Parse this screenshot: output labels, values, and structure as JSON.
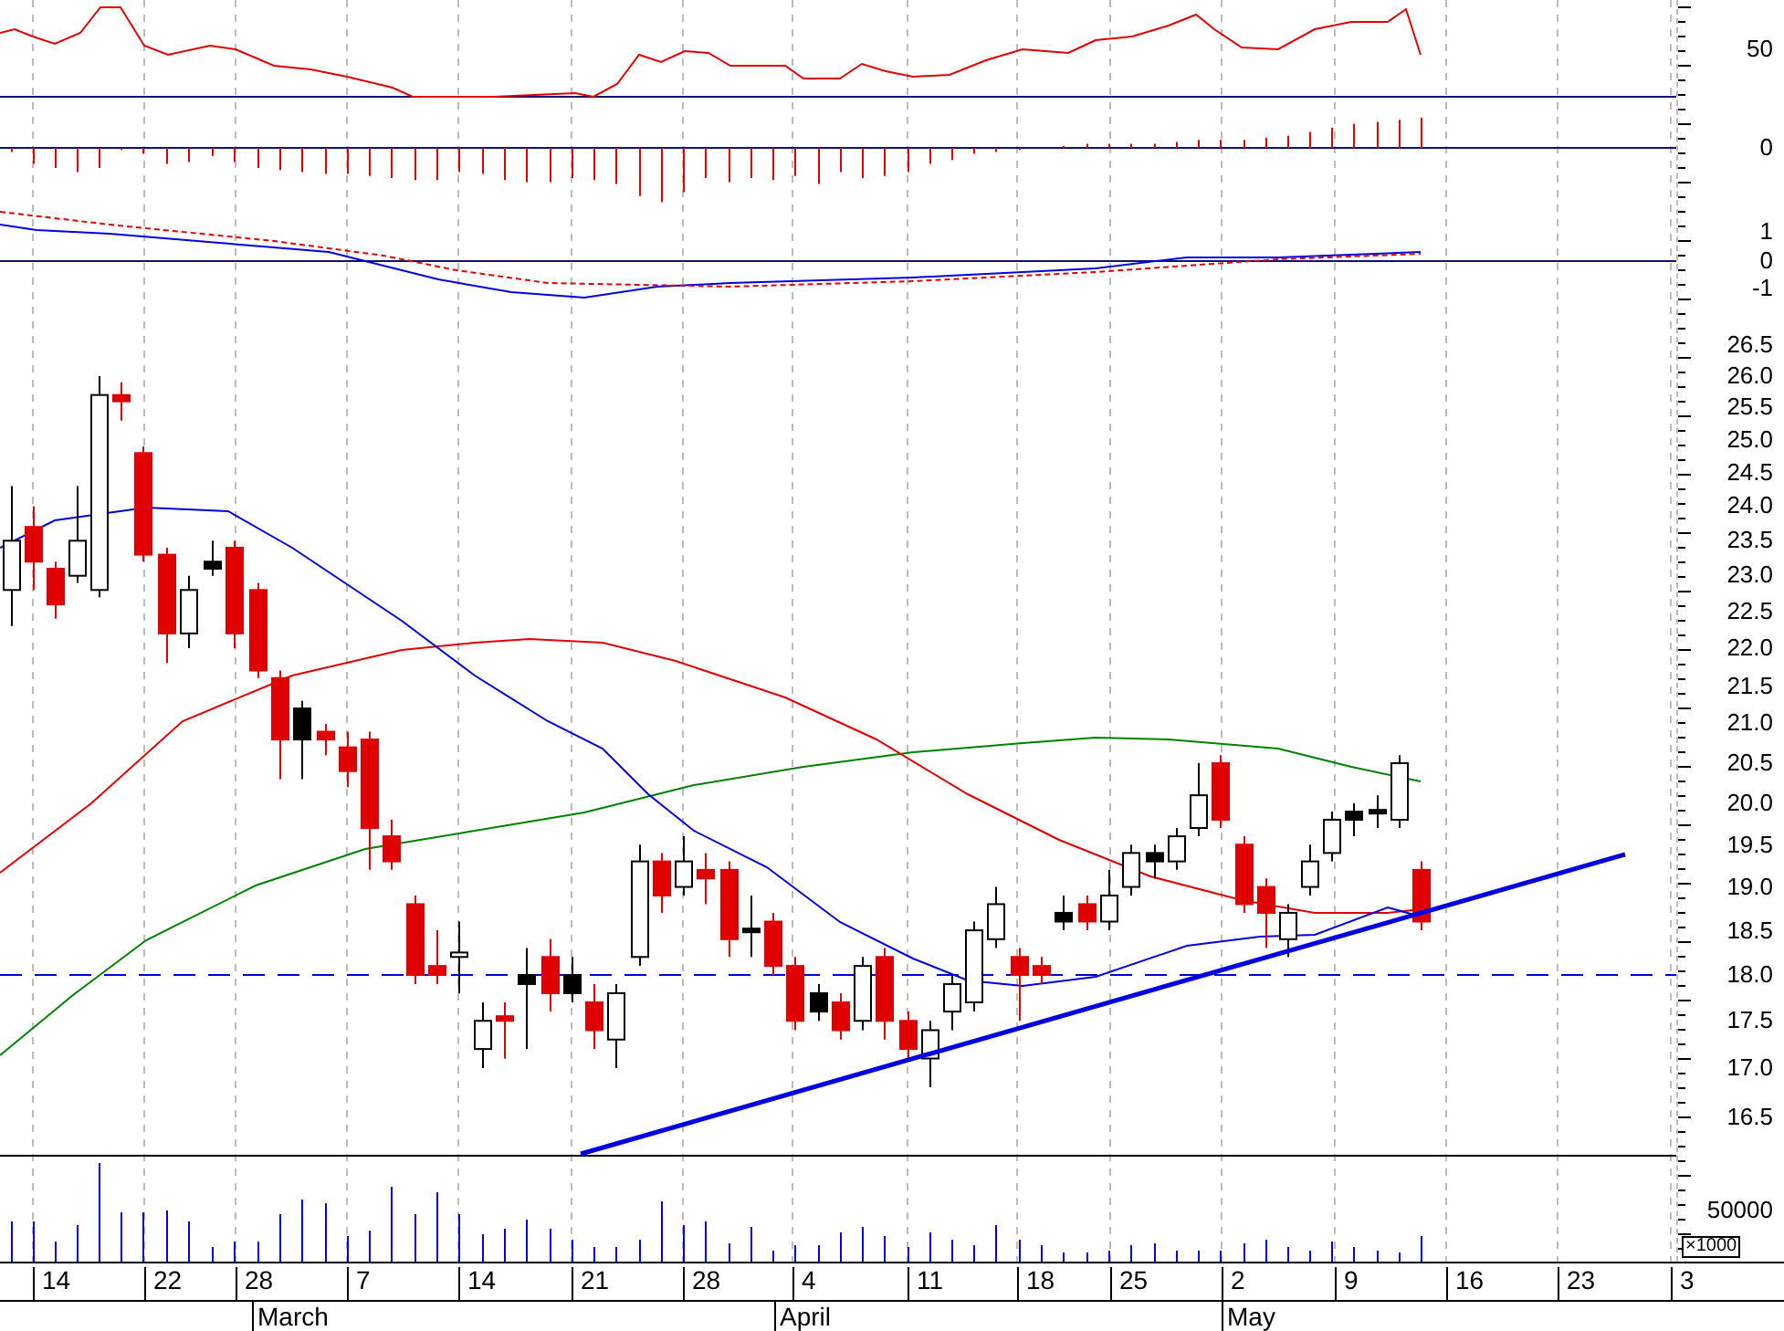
{
  "right_axis": {
    "rsi": [
      "50"
    ],
    "histogram": [
      "0"
    ],
    "macd": [
      "1",
      "0",
      "-1"
    ],
    "price": [
      "26.5",
      "26.0",
      "25.5",
      "25.0",
      "24.5",
      "24.0",
      "23.5",
      "23.0",
      "22.5",
      "22.0",
      "21.5",
      "21.0",
      "20.5",
      "20.0",
      "19.5",
      "19.0",
      "18.5",
      "18.0",
      "17.5",
      "17.0",
      "16.5"
    ],
    "volume": [
      "50000"
    ],
    "volume_unit": "×1000"
  },
  "date_axis": {
    "days": [
      "14",
      "22",
      "28",
      "7",
      "14",
      "21",
      "28",
      "4",
      "11",
      "18",
      "25",
      "2",
      "9",
      "16",
      "23",
      "3"
    ],
    "months": [
      "March",
      "April",
      "May"
    ]
  }
}
